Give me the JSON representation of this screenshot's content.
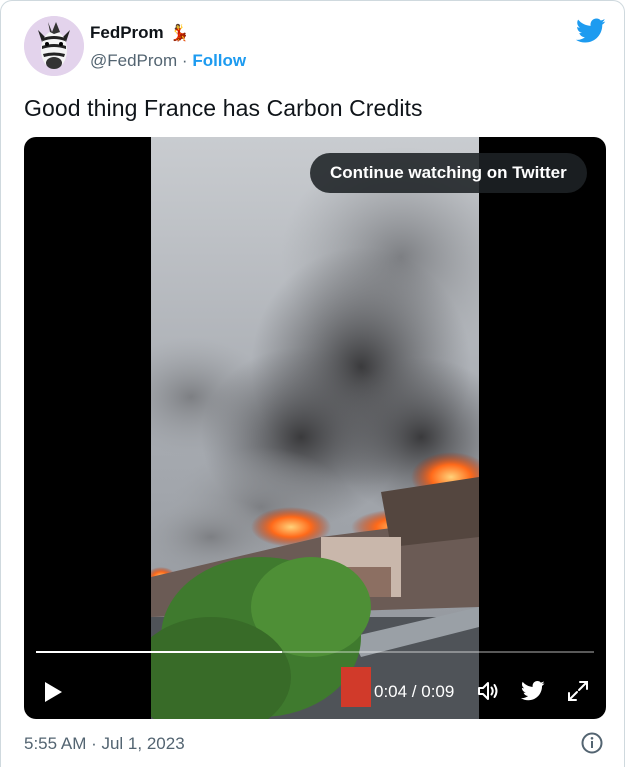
{
  "tweet": {
    "display_name": "FedProm",
    "name_emoji": "💃",
    "handle": "@FedProm",
    "separator": "·",
    "follow_label": "Follow",
    "text": "Good thing France has Carbon Credits",
    "timestamp": "5:55 AM · Jul 1, 2023"
  },
  "video": {
    "continue_label": "Continue watching on Twitter",
    "time_display": "0:04 / 0:09",
    "progress_fraction": 0.44
  },
  "icons": {
    "brand": "twitter-bird-icon",
    "play": "play-icon",
    "volume": "volume-icon",
    "share": "twitter-bird-icon",
    "fullscreen": "fullscreen-icon",
    "info": "info-icon"
  },
  "colors": {
    "accent": "#1d9bf0",
    "secondary_text": "#536471",
    "primary_text": "#0f1419"
  }
}
